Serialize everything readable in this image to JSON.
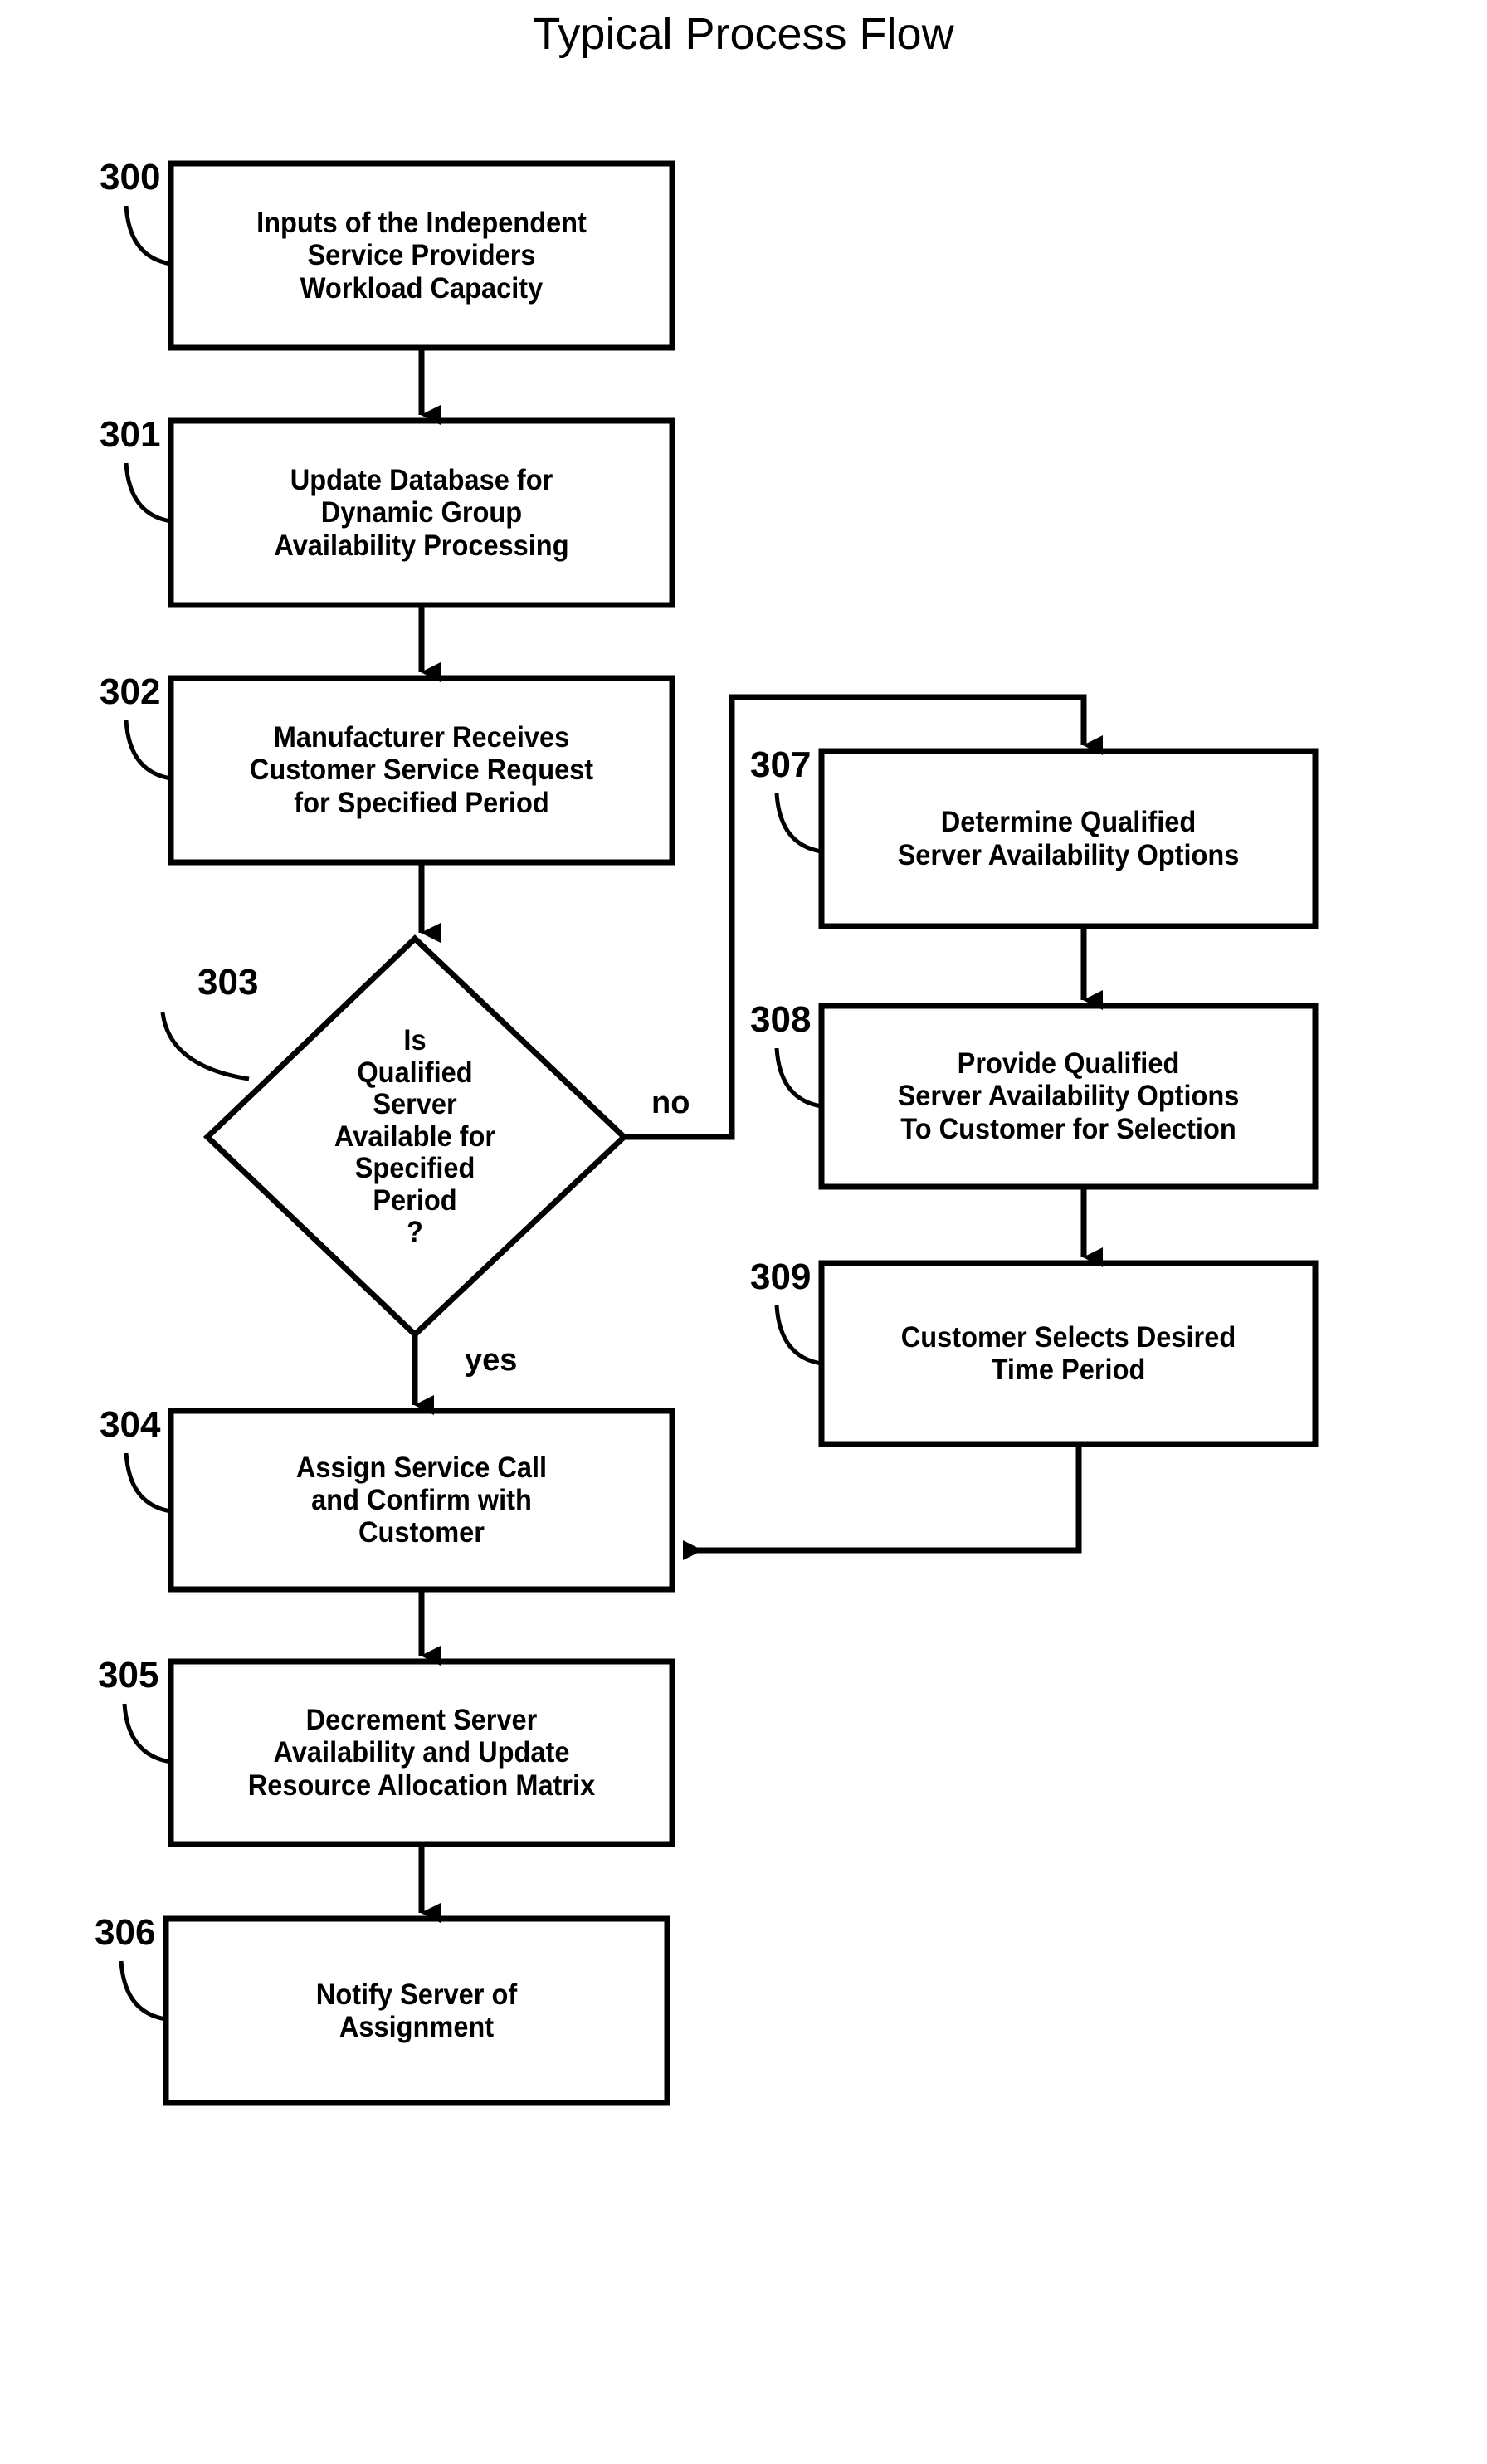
{
  "figure": {
    "title": "Typical Process Flow",
    "background_color": "#ffffff",
    "line_color": "#000000"
  },
  "nodes": [
    {
      "ref": "300",
      "shape": "rect",
      "text": "Inputs of the Independent\nService Providers\nWorkload Capacity"
    },
    {
      "ref": "301",
      "shape": "rect",
      "text": "Update Database for\nDynamic Group\nAvailability Processing"
    },
    {
      "ref": "302",
      "shape": "rect",
      "text": "Manufacturer Receives\nCustomer Service Request\nfor Specified Period"
    },
    {
      "ref": "303",
      "shape": "diamond",
      "text": "Is\nQualified\nServer\nAvailable for\nSpecified\nPeriod\n?"
    },
    {
      "ref": "304",
      "shape": "rect",
      "text": "Assign Service Call\nand Confirm with\nCustomer"
    },
    {
      "ref": "305",
      "shape": "rect",
      "text": "Decrement Server\nAvailability and Update\nResource Allocation Matrix"
    },
    {
      "ref": "306",
      "shape": "rect",
      "text": "Notify Server of\nAssignment"
    },
    {
      "ref": "307",
      "shape": "rect",
      "text": "Determine Qualified\nServer Availability Options"
    },
    {
      "ref": "308",
      "shape": "rect",
      "text": "Provide Qualified\nServer Availability Options\nTo Customer for Selection"
    },
    {
      "ref": "309",
      "shape": "rect",
      "text": "Customer Selects Desired\nTime Period"
    }
  ],
  "edge_labels": {
    "no": "no",
    "yes": "yes"
  }
}
